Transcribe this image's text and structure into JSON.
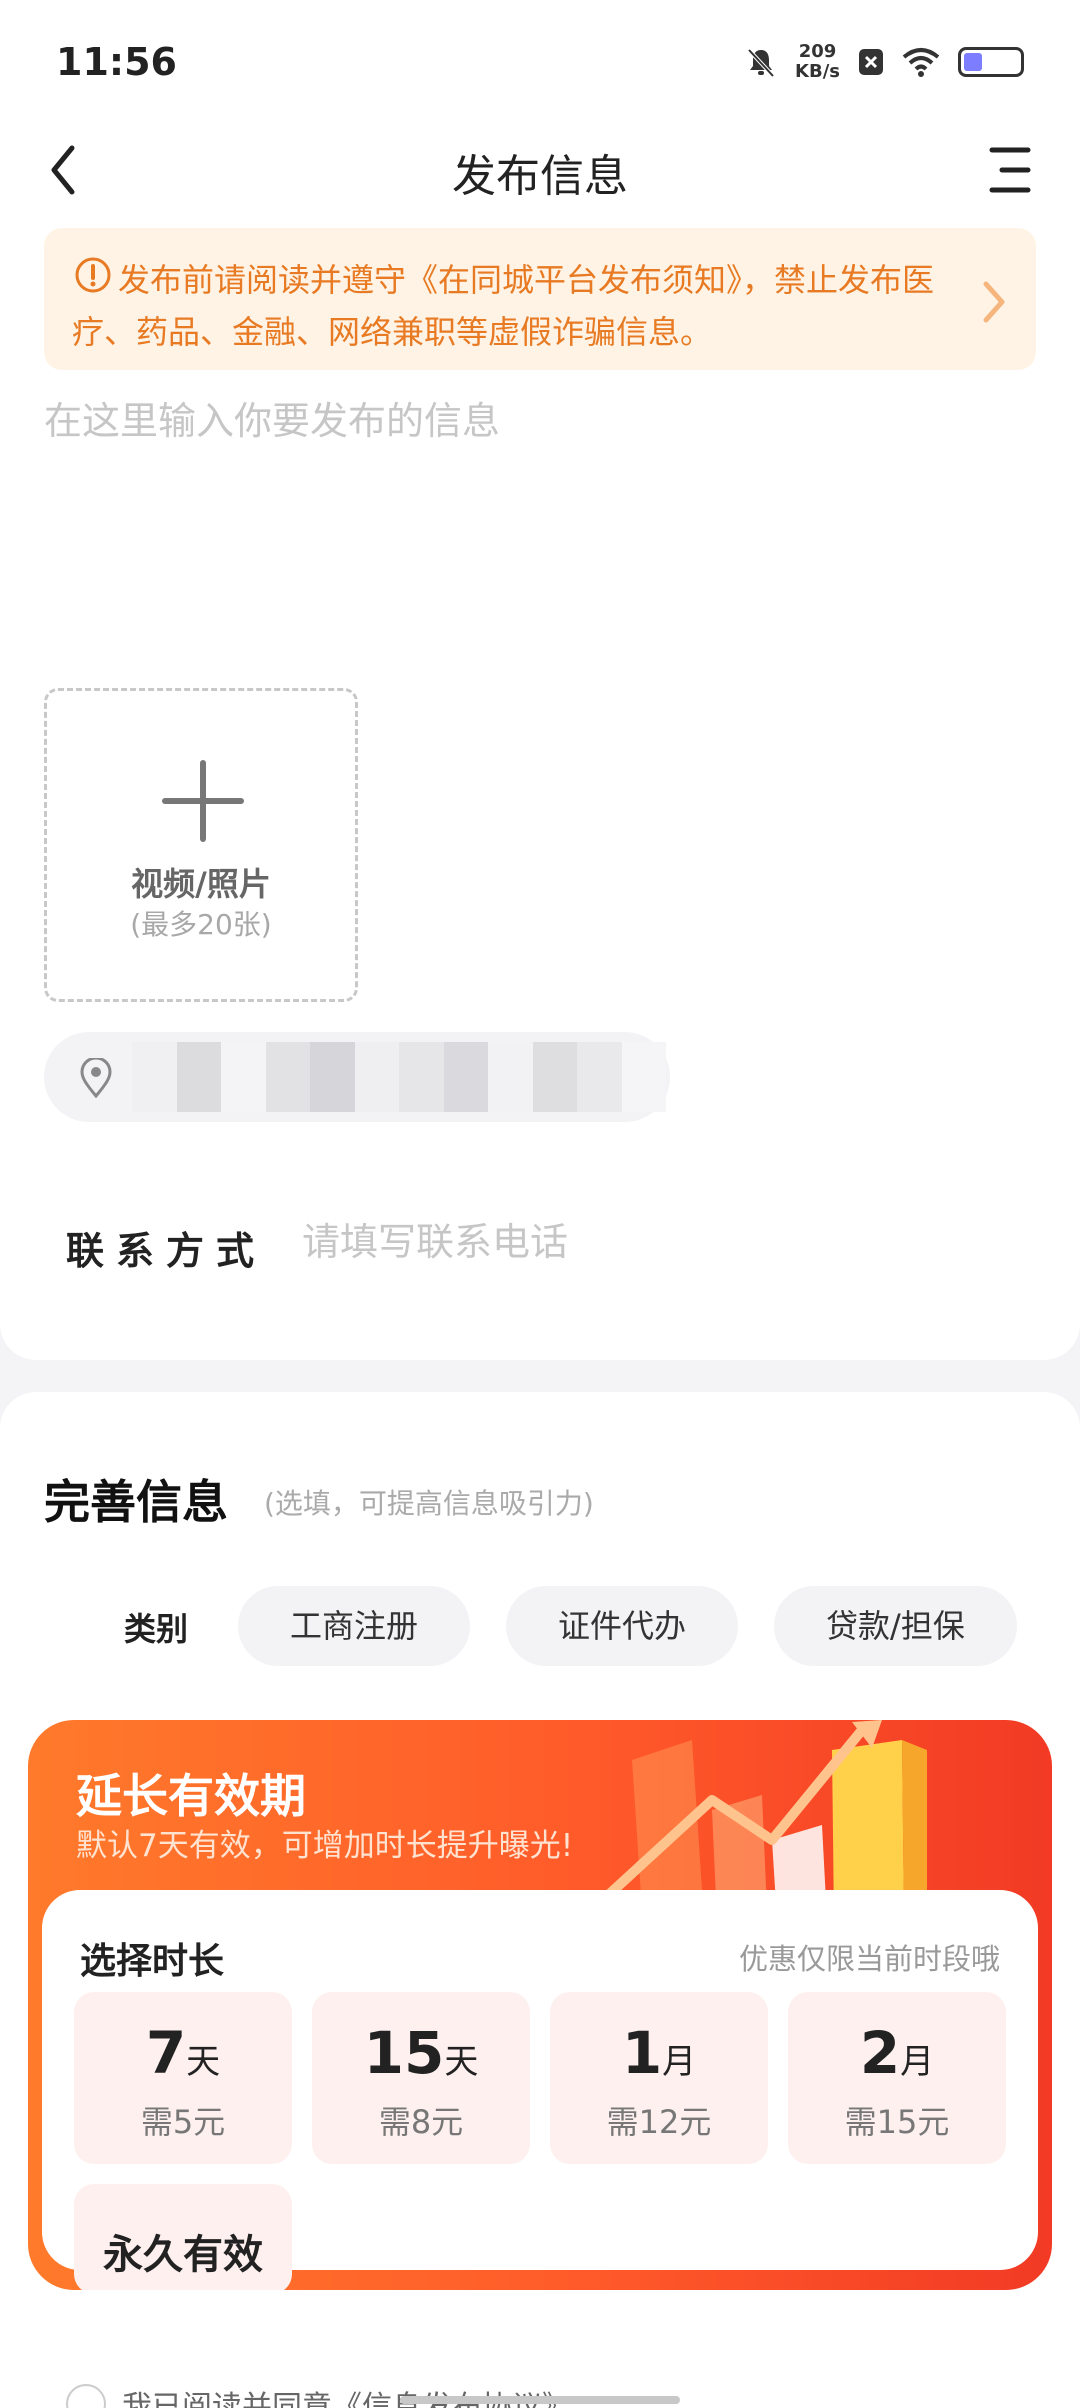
{
  "status_bar": {
    "time": "11:56",
    "speed_value": "209",
    "speed_unit": "KB/s"
  },
  "nav": {
    "title": "发布信息"
  },
  "notice": {
    "text": "发布前请阅读并遵守《在同城平台发布须知》，禁止发布医疗、药品、金融、网络兼职等虚假诈骗信息。"
  },
  "editor": {
    "placeholder": "在这里输入你要发布的信息"
  },
  "upload": {
    "label": "视频/照片",
    "hint": "(最多20张)"
  },
  "location": {
    "text": "吉"
  },
  "contact": {
    "label": "联系方式",
    "placeholder": "请填写联系电话"
  },
  "details": {
    "title": "完善信息",
    "subtitle": "(选填，可提高信息吸引力)",
    "category_label": "类别",
    "categories": [
      "工商注册",
      "证件代办",
      "贷款/担保"
    ]
  },
  "promo": {
    "title": "延长有效期",
    "subtitle": "默认7天有效，可增加时长提升曝光!",
    "panel_title": "选择时长",
    "panel_note": "优惠仅限当前时段哦",
    "options": [
      {
        "num": "7",
        "unit": "天",
        "price": "需5元"
      },
      {
        "num": "15",
        "unit": "天",
        "price": "需8元"
      },
      {
        "num": "1",
        "unit": "月",
        "price": "需12元"
      },
      {
        "num": "2",
        "unit": "月",
        "price": "需15元"
      }
    ],
    "forever": "永久有效"
  },
  "agreement": {
    "text": "我已阅读并同意《信息发布协议》"
  }
}
